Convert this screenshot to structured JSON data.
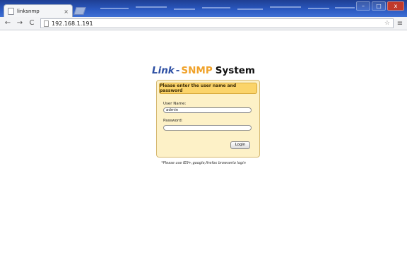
{
  "browser": {
    "tab_title": "linksnmp",
    "tab_close": "×",
    "url": "192.168.1.191",
    "back_icon": "←",
    "forward_icon": "→",
    "reload_icon": "C",
    "star_icon": "☆",
    "menu_icon": "≡",
    "window_controls": {
      "minimize": "–",
      "maximize": "□",
      "close": "x"
    }
  },
  "page": {
    "heading": {
      "link": "Link",
      "dash": "-",
      "snmp": "SNMP",
      "system": "System"
    },
    "login": {
      "header": "Please enter the user name and password",
      "username_label": "User Name:",
      "username_value": "admin",
      "password_label": "Password:",
      "password_value": "",
      "button": "Login"
    },
    "note": "*Please use IE9+,google,firefox browserto login"
  },
  "colors": {
    "titlebar": "#2a58c0",
    "brand_blue": "#2d4fa3",
    "brand_orange": "#f0a22a",
    "login_header": "#fbd46a",
    "login_box": "#fdf1c7"
  }
}
